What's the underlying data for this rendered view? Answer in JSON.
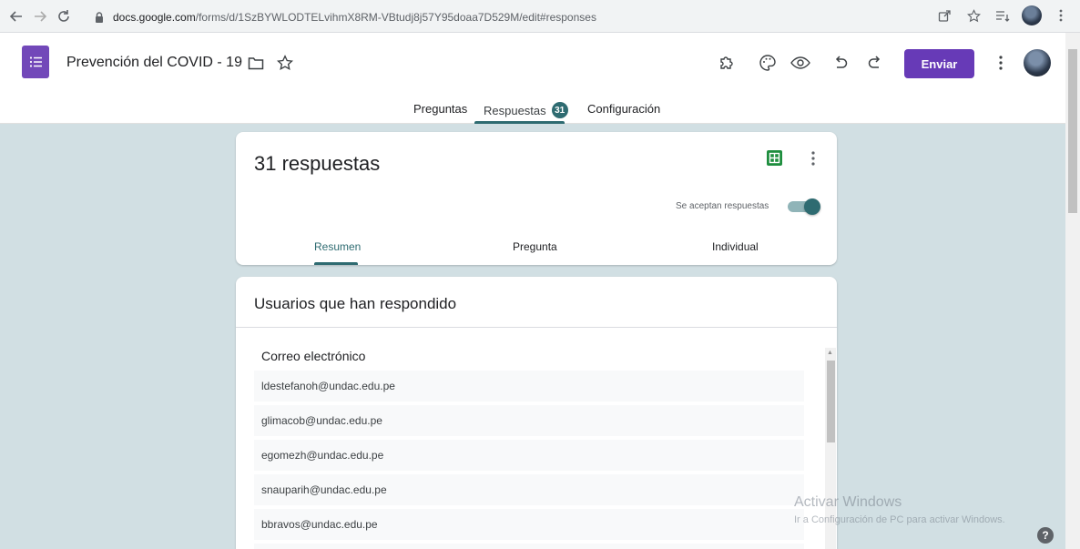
{
  "browser": {
    "url_domain": "docs.google.com",
    "url_path": "/forms/d/1SzBYWLODTELvihmX8RM-VBtudj8j57Y95doaa7D529M/edit#responses"
  },
  "header": {
    "doc_title": "Prevención del COVID - 19",
    "send_label": "Enviar"
  },
  "tabs": [
    {
      "label": "Preguntas"
    },
    {
      "label": "Respuestas",
      "badge": "31"
    },
    {
      "label": "Configuración"
    }
  ],
  "summary_card": {
    "title": "31 respuestas",
    "accepting_label": "Se aceptan respuestas",
    "accepting_on": true,
    "subtabs": [
      {
        "label": "Resumen"
      },
      {
        "label": "Pregunta"
      },
      {
        "label": "Individual"
      }
    ]
  },
  "users_card": {
    "title": "Usuarios que han respondido",
    "column_header": "Correo electrónico",
    "emails": [
      "ldestefanoh@undac.edu.pe",
      "glimacob@undac.edu.pe",
      "egomezh@undac.edu.pe",
      "snauparih@undac.edu.pe",
      "bbravos@undac.edu.pe"
    ]
  },
  "watermark": {
    "title": "Activar Windows",
    "subtitle": "Ir a Configuración de PC para activar Windows."
  },
  "help_label": "?",
  "colors": {
    "accent": "#673ab7",
    "teal": "#2e6b71",
    "page_bg": "#d1dfe3"
  }
}
